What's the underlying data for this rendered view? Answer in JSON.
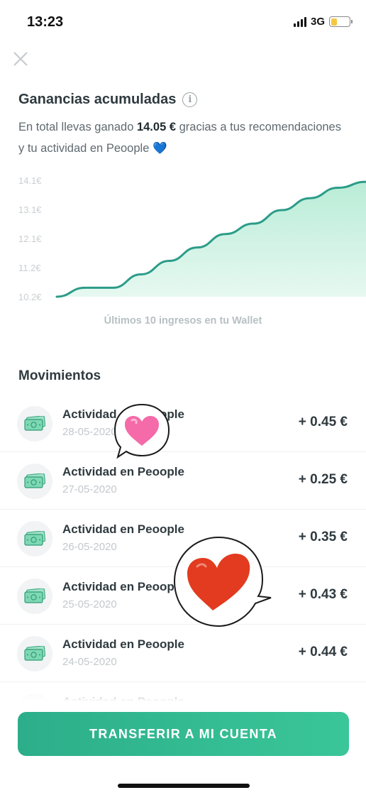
{
  "status_bar": {
    "time": "13:23",
    "network": "3G",
    "battery_level": 0.35
  },
  "header": {
    "close_icon": "close-icon"
  },
  "earnings": {
    "title": "Ganancias acumuladas",
    "info_icon": "info-icon",
    "summary_prefix": "En total llevas ganado ",
    "summary_amount": "14.05 €",
    "summary_suffix": " gracias a tus recomendaciones y tu actividad en Peoople ",
    "summary_emoji": "💙"
  },
  "chart_data": {
    "type": "area",
    "x": [
      1,
      2,
      3,
      4,
      5,
      6,
      7,
      8,
      9,
      10,
      11
    ],
    "values": [
      10.2,
      10.5,
      10.5,
      10.95,
      11.4,
      11.85,
      12.3,
      12.65,
      13.1,
      13.5,
      13.85,
      14.05
    ],
    "yticks": [
      "14.1€",
      "13.1€",
      "12.1€",
      "11.2€",
      "10.2€"
    ],
    "ylim": [
      10.2,
      14.1
    ],
    "caption": "Últimos 10 ingresos en tu Wallet",
    "line_color": "#2b9c88",
    "fill_color": "#b9ecd7",
    "grid": false
  },
  "movements": {
    "title": "Movimientos",
    "items": [
      {
        "label": "Actividad en Peoople",
        "date": "28-05-2020",
        "amount": "+ 0.45 €"
      },
      {
        "label": "Actividad en Peoople",
        "date": "27-05-2020",
        "amount": "+ 0.25 €"
      },
      {
        "label": "Actividad en Peoople",
        "date": "26-05-2020",
        "amount": "+ 0.35 €"
      },
      {
        "label": "Actividad en Peoople",
        "date": "25-05-2020",
        "amount": "+ 0.43 €"
      },
      {
        "label": "Actividad en Peoople",
        "date": "24-05-2020",
        "amount": "+ 0.44 €"
      },
      {
        "label": "Actividad en Peoople",
        "date": "",
        "amount": ""
      }
    ]
  },
  "stickers": {
    "pink": "heart-speech-bubble-pink",
    "red": "heart-speech-bubble-red"
  },
  "cta": {
    "label": "TRANSFERIR A MI CUENTA"
  },
  "colors": {
    "accent": "#34b891",
    "text": "#2f3a3f",
    "muted": "#b7c0c4"
  }
}
